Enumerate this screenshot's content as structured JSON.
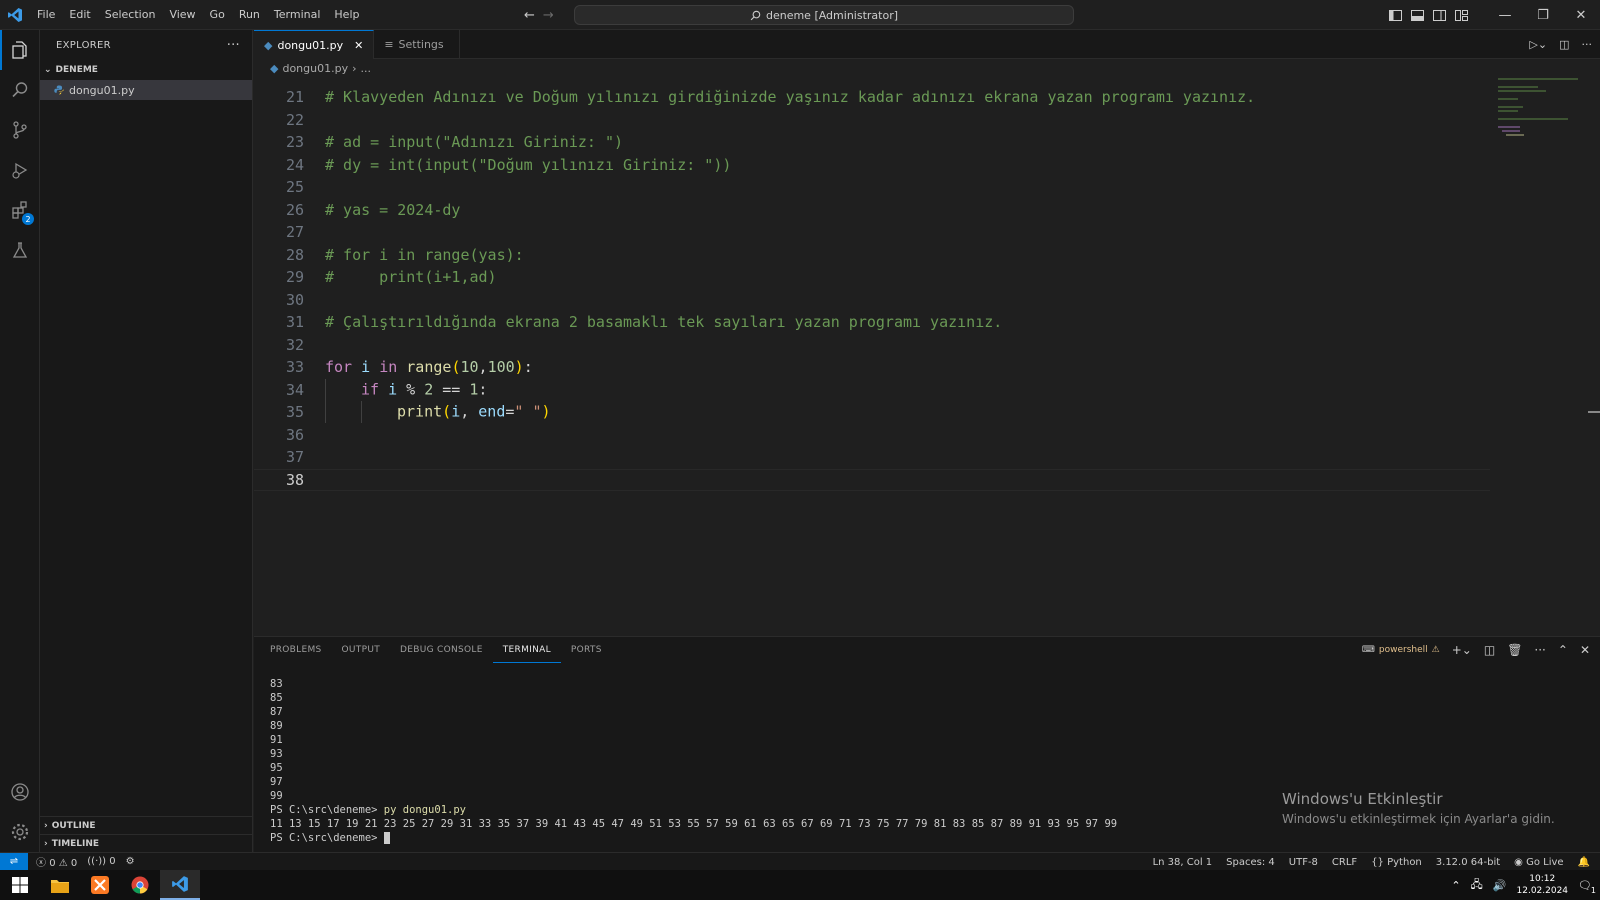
{
  "titlebar": {
    "menu": [
      "File",
      "Edit",
      "Selection",
      "View",
      "Go",
      "Run",
      "Terminal",
      "Help"
    ],
    "command_center": "deneme [Administrator]"
  },
  "activity": {
    "extensions_badge": "2"
  },
  "sidebar": {
    "title": "EXPLORER",
    "folder": "DENEME",
    "files": [
      "dongu01.py"
    ],
    "outline": "OUTLINE",
    "timeline": "TIMELINE"
  },
  "editor": {
    "tabs": [
      {
        "label": "dongu01.py",
        "active": true
      },
      {
        "label": "Settings",
        "active": false
      }
    ],
    "breadcrumb": {
      "file": "dongu01.py",
      "more": "..."
    },
    "current_line": 38,
    "lines": [
      {
        "n": 21,
        "tokens": [
          [
            "cm",
            "# Klavyeden Adınızı ve Doğum yılınızı girdiğinizde yaşınız kadar adınızı ekrana yazan programı yazınız."
          ]
        ]
      },
      {
        "n": 22,
        "tokens": []
      },
      {
        "n": 23,
        "tokens": [
          [
            "cm",
            "# ad = input(\"Adınızı Giriniz: \")"
          ]
        ]
      },
      {
        "n": 24,
        "tokens": [
          [
            "cm",
            "# dy = int(input(\"Doğum yılınızı Giriniz: \"))"
          ]
        ]
      },
      {
        "n": 25,
        "tokens": []
      },
      {
        "n": 26,
        "tokens": [
          [
            "cm",
            "# yas = 2024-dy"
          ]
        ]
      },
      {
        "n": 27,
        "tokens": []
      },
      {
        "n": 28,
        "tokens": [
          [
            "cm",
            "# for i in range(yas):"
          ]
        ]
      },
      {
        "n": 29,
        "tokens": [
          [
            "cm",
            "#     print(i+1,ad)"
          ]
        ]
      },
      {
        "n": 30,
        "tokens": []
      },
      {
        "n": 31,
        "tokens": [
          [
            "cm",
            "# Çalıştırıldığında ekrana 2 basamaklı tek sayıları yazan programı yazınız."
          ]
        ]
      },
      {
        "n": 32,
        "tokens": []
      },
      {
        "n": 33,
        "tokens": [
          [
            "kw",
            "for"
          ],
          [
            "op",
            " "
          ],
          [
            "vr",
            "i"
          ],
          [
            "op",
            " "
          ],
          [
            "kw",
            "in"
          ],
          [
            "op",
            " "
          ],
          [
            "fn",
            "range"
          ],
          [
            "pn",
            "("
          ],
          [
            "nm",
            "10"
          ],
          [
            "op",
            ","
          ],
          [
            "nm",
            "100"
          ],
          [
            "pn",
            ")"
          ],
          [
            "op",
            ":"
          ]
        ]
      },
      {
        "n": 34,
        "indent": 1,
        "tokens": [
          [
            "kw",
            "if"
          ],
          [
            "op",
            " "
          ],
          [
            "vr",
            "i"
          ],
          [
            "op",
            " % "
          ],
          [
            "nm",
            "2"
          ],
          [
            "op",
            " == "
          ],
          [
            "nm",
            "1"
          ],
          [
            "op",
            ":"
          ]
        ]
      },
      {
        "n": 35,
        "indent": 2,
        "tokens": [
          [
            "fn",
            "print"
          ],
          [
            "pn",
            "("
          ],
          [
            "vr",
            "i"
          ],
          [
            "op",
            ", "
          ],
          [
            "vr",
            "end"
          ],
          [
            "op",
            "="
          ],
          [
            "st",
            "\" \""
          ],
          [
            "pn",
            ")"
          ]
        ]
      },
      {
        "n": 36,
        "tokens": []
      },
      {
        "n": 37,
        "tokens": []
      },
      {
        "n": 38,
        "tokens": []
      }
    ]
  },
  "panel": {
    "tabs": [
      {
        "label": "PROBLEMS"
      },
      {
        "label": "OUTPUT"
      },
      {
        "label": "DEBUG CONSOLE"
      },
      {
        "label": "TERMINAL",
        "active": true
      },
      {
        "label": "PORTS"
      }
    ],
    "shell": "powershell",
    "terminal": {
      "history": [
        "83",
        "85",
        "87",
        "89",
        "91",
        "93",
        "95",
        "97",
        "99"
      ],
      "prompt": "PS C:\\src\\deneme> ",
      "command": "py dongu01.py",
      "output": "11 13 15 17 19 21 23 25 27 29 31 33 35 37 39 41 43 45 47 49 51 53 55 57 59 61 63 65 67 69 71 73 75 77 79 81 83 85 87 89 91 93 95 97 99",
      "prompt2": "PS C:\\src\\deneme> "
    }
  },
  "watermark": {
    "title": "Windows'u Etkinleştir",
    "subtitle": "Windows'u etkinleştirmek için Ayarlar'a gidin."
  },
  "statusbar": {
    "errors": "0",
    "warnings": "0",
    "ports": "0",
    "position": "Ln 38, Col 1",
    "spaces": "Spaces: 4",
    "encoding": "UTF-8",
    "eol": "CRLF",
    "language": "Python",
    "interpreter": "3.12.0 64-bit",
    "golive": "Go Live"
  },
  "taskbar": {
    "time": "10:12",
    "date": "12.02.2024",
    "notifications": "1"
  }
}
